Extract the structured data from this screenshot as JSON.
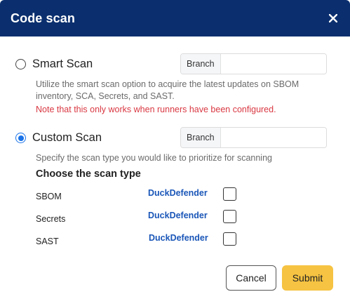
{
  "dialog": {
    "title": "Code scan",
    "close_icon": "close-icon"
  },
  "smart_scan": {
    "label": "Smart Scan",
    "selected": false,
    "branch_label": "Branch",
    "branch_value": "",
    "description": "Utilize the smart scan option to acquire the latest updates on SBOM inventory, SCA, Secrets, and SAST.",
    "note": "Note that this only works when runners have been configured."
  },
  "custom_scan": {
    "label": "Custom Scan",
    "selected": true,
    "branch_label": "Branch",
    "branch_value": "",
    "description": "Specify the scan type you would like to prioritize for scanning",
    "section_title": "Choose the scan type",
    "types": [
      {
        "label": "SBOM",
        "vendor": "DuckDefender",
        "checked": false
      },
      {
        "label": "Secrets",
        "vendor": "DuckDefender",
        "checked": false
      },
      {
        "label": "SAST",
        "vendor": "DuckDefender",
        "checked": false
      }
    ]
  },
  "actions": {
    "cancel_label": "Cancel",
    "submit_label": "Submit"
  },
  "colors": {
    "header": "#0b2f6e",
    "accent": "#1a73e8",
    "note": "#d93842",
    "vendor": "#1a56b8",
    "submit": "#f6c342"
  }
}
